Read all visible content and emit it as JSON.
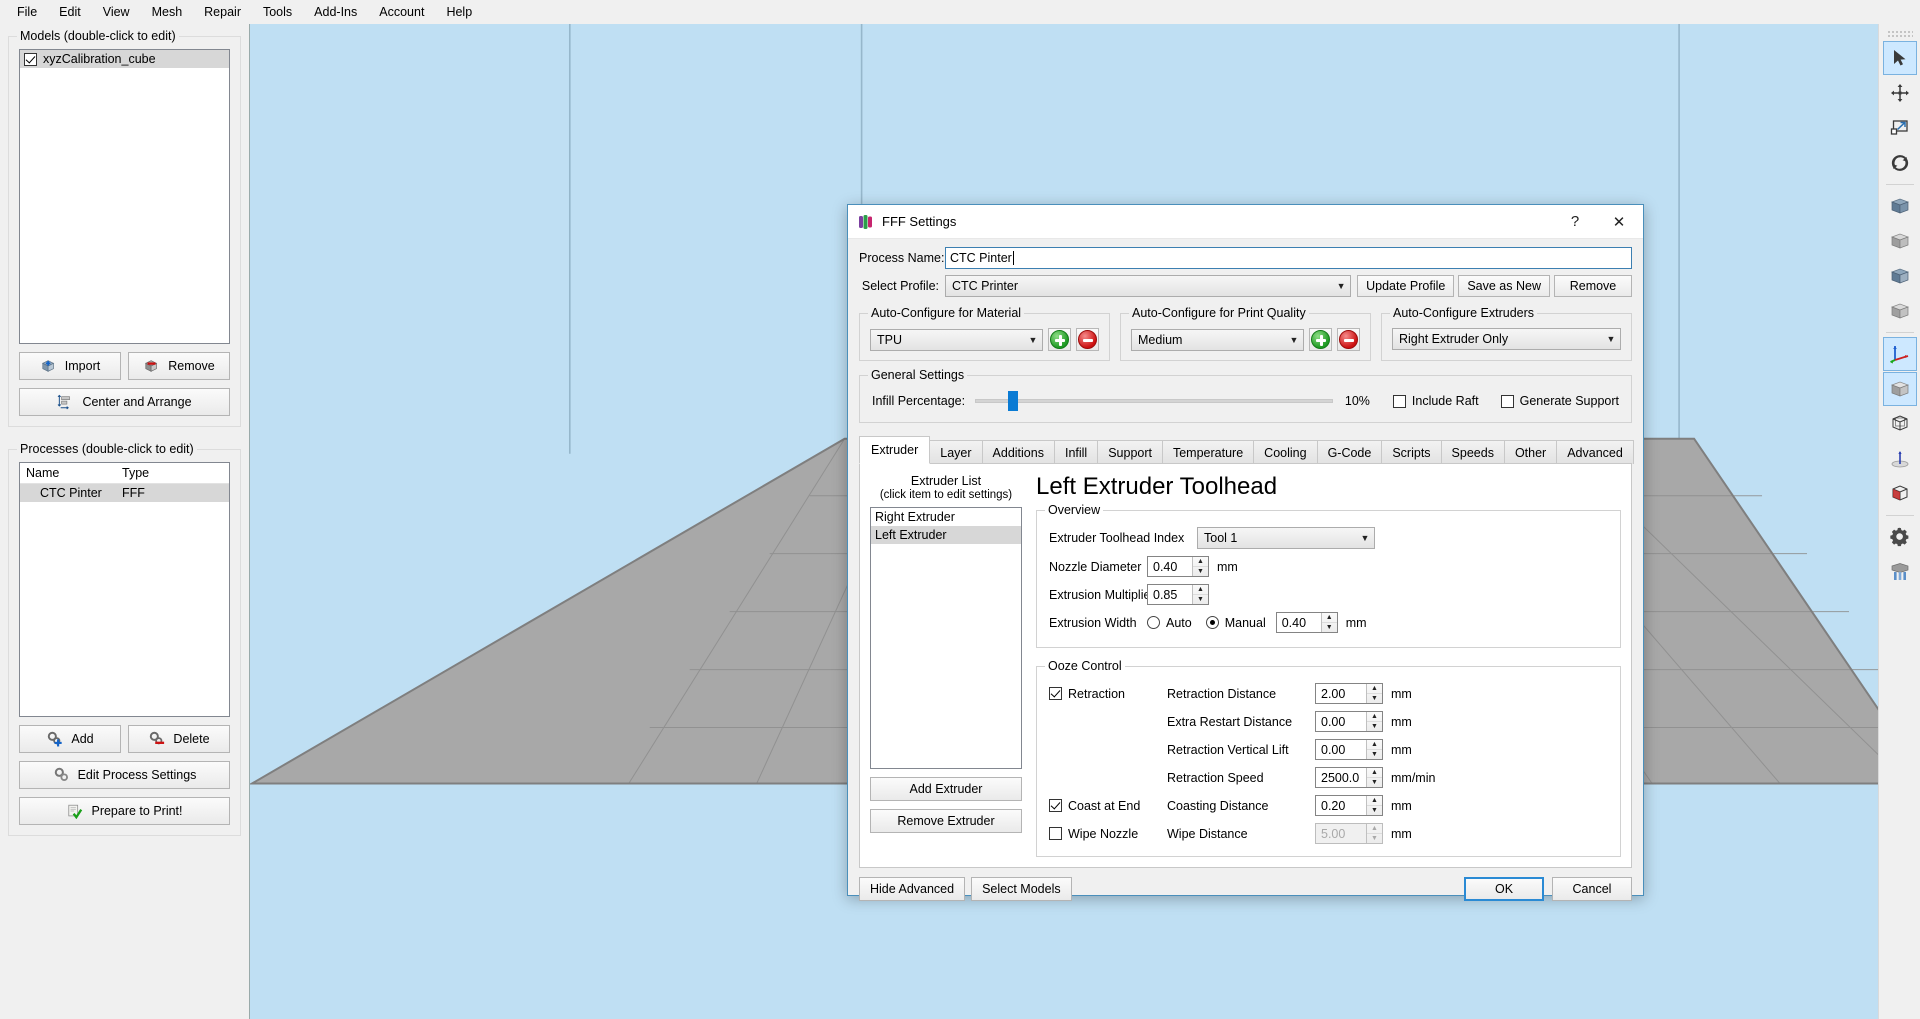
{
  "menubar": {
    "items": [
      "File",
      "Edit",
      "View",
      "Mesh",
      "Repair",
      "Tools",
      "Add-Ins",
      "Account",
      "Help"
    ]
  },
  "left_panel": {
    "models_group": {
      "title": "Models (double-click to edit)",
      "items": [
        {
          "label": "xyzCalibration_cube",
          "checked": true,
          "selected": true
        }
      ],
      "import_label": "Import",
      "remove_label": "Remove",
      "center_label": "Center and Arrange"
    },
    "processes_group": {
      "title": "Processes (double-click to edit)",
      "columns": [
        "Name",
        "Type"
      ],
      "rows": [
        {
          "name": "CTC Pinter",
          "type": "FFF",
          "selected": true
        }
      ],
      "add_label": "Add",
      "delete_label": "Delete",
      "edit_label": "Edit Process Settings",
      "prepare_label": "Prepare to Print!"
    }
  },
  "right_toolbar": {
    "tools": [
      {
        "name": "select-arrow-icon",
        "active": true
      },
      {
        "name": "move-icon",
        "active": false
      },
      {
        "name": "scale-icon",
        "active": false
      },
      {
        "name": "rotate-icon",
        "active": false
      },
      {
        "name": "view-front-icon",
        "active": false
      },
      {
        "name": "view-back-icon",
        "active": false
      },
      {
        "name": "view-left-icon",
        "active": false
      },
      {
        "name": "view-right-icon",
        "active": false
      },
      {
        "name": "axes-icon",
        "active": true
      },
      {
        "name": "view-iso-icon",
        "active": true
      },
      {
        "name": "wireframe-icon",
        "active": false
      },
      {
        "name": "origin-icon",
        "active": false
      },
      {
        "name": "cross-section-icon",
        "active": false
      },
      {
        "name": "gear-icon",
        "active": false
      },
      {
        "name": "supports-icon",
        "active": false
      }
    ]
  },
  "dialog": {
    "title": "FFF Settings",
    "help_glyph": "?",
    "close_glyph": "✕",
    "process_name_label": "Process Name:",
    "process_name_value": "CTC Pinter",
    "select_profile_label": "Select Profile:",
    "select_profile_value": "CTC Printer",
    "update_profile_label": "Update Profile",
    "save_as_new_label": "Save as New",
    "remove_label": "Remove",
    "material_group": {
      "title": "Auto-Configure for Material",
      "value": "TPU",
      "add_name": "add-material-button",
      "remove_name": "remove-material-button"
    },
    "quality_group": {
      "title": "Auto-Configure for Print Quality",
      "value": "Medium",
      "add_name": "add-quality-button",
      "remove_name": "remove-quality-button"
    },
    "extruders_group": {
      "title": "Auto-Configure Extruders",
      "value": "Right Extruder Only"
    },
    "general_group": {
      "title": "General Settings",
      "infill_label": "Infill Percentage:",
      "infill_value": "10%",
      "infill_percent": 10,
      "include_raft_label": "Include Raft",
      "include_raft_checked": false,
      "generate_support_label": "Generate Support",
      "generate_support_checked": false
    },
    "tabs": [
      {
        "label": "Extruder",
        "active": true
      },
      {
        "label": "Layer",
        "active": false
      },
      {
        "label": "Additions",
        "active": false
      },
      {
        "label": "Infill",
        "active": false
      },
      {
        "label": "Support",
        "active": false
      },
      {
        "label": "Temperature",
        "active": false
      },
      {
        "label": "Cooling",
        "active": false
      },
      {
        "label": "G-Code",
        "active": false
      },
      {
        "label": "Scripts",
        "active": false
      },
      {
        "label": "Speeds",
        "active": false
      },
      {
        "label": "Other",
        "active": false
      },
      {
        "label": "Advanced",
        "active": false
      }
    ],
    "extruder_tab": {
      "list_title_line1": "Extruder List",
      "list_title_line2": "(click item to edit settings)",
      "list_items": [
        {
          "label": "Right Extruder",
          "selected": false
        },
        {
          "label": "Left Extruder",
          "selected": true
        }
      ],
      "add_extruder_label": "Add Extruder",
      "remove_extruder_label": "Remove Extruder",
      "panel_title": "Left Extruder Toolhead",
      "overview": {
        "title": "Overview",
        "toolhead_index_label": "Extruder Toolhead Index",
        "toolhead_index_value": "Tool 1",
        "nozzle_diameter_label": "Nozzle Diameter",
        "nozzle_diameter_value": "0.40",
        "nozzle_diameter_unit": "mm",
        "extrusion_multiplier_label": "Extrusion Multiplier",
        "extrusion_multiplier_value": "0.85",
        "extrusion_width_label": "Extrusion Width",
        "extrusion_width_auto_label": "Auto",
        "extrusion_width_manual_label": "Manual",
        "extrusion_width_mode": "Manual",
        "extrusion_width_value": "0.40",
        "extrusion_width_unit": "mm"
      },
      "ooze": {
        "title": "Ooze Control",
        "retraction_label": "Retraction",
        "retraction_checked": true,
        "coast_label": "Coast at End",
        "coast_checked": true,
        "wipe_label": "Wipe Nozzle",
        "wipe_checked": false,
        "rows": [
          {
            "label": "Retraction Distance",
            "value": "2.00",
            "unit": "mm",
            "disabled": false
          },
          {
            "label": "Extra Restart Distance",
            "value": "0.00",
            "unit": "mm",
            "disabled": false
          },
          {
            "label": "Retraction Vertical Lift",
            "value": "0.00",
            "unit": "mm",
            "disabled": false
          },
          {
            "label": "Retraction Speed",
            "value": "2500.0",
            "unit": "mm/min",
            "disabled": false
          },
          {
            "label": "Coasting Distance",
            "value": "0.20",
            "unit": "mm",
            "disabled": false
          },
          {
            "label": "Wipe Distance",
            "value": "5.00",
            "unit": "mm",
            "disabled": true
          }
        ]
      }
    },
    "footer": {
      "hide_advanced_label": "Hide Advanced",
      "select_models_label": "Select Models",
      "ok_label": "OK",
      "cancel_label": "Cancel"
    }
  },
  "colors": {
    "viewport_bg": "#bfdff3",
    "bed_top": "#a8a8a8",
    "accent_blue": "#0a7bd4",
    "selection_gray": "#d7d7d7"
  }
}
